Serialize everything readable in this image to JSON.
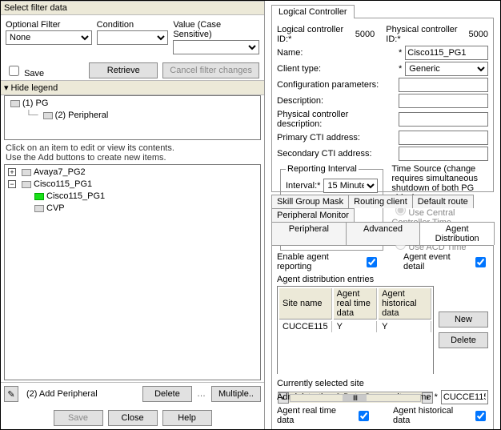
{
  "left": {
    "select_filter_title": "Select filter data",
    "optional_filter_label": "Optional Filter",
    "optional_filter_value": "None",
    "condition_label": "Condition",
    "condition_value": "",
    "value_label": "Value (Case Sensitive)",
    "value_value": "",
    "save_checkbox_label": "Save",
    "retrieve_btn": "Retrieve",
    "cancel_filter_btn": "Cancel filter changes",
    "hide_legend_label": "Hide legend",
    "legend_tree": {
      "item1": "(1) PG",
      "item2": "(2) Peripheral"
    },
    "instruction_line1": "Click on an item to edit or view its contents.",
    "instruction_line2": "Use the Add buttons to create new items.",
    "main_tree": {
      "n0": "Avaya7_PG2",
      "n1": "Cisco115_PG1",
      "n2": "Cisco115_PG1",
      "n3": "CVP"
    },
    "add_peripheral_label": "(2) Add Peripheral",
    "delete_btn": "Delete",
    "multiple_btn": "Multiple..",
    "save_btn": "Save",
    "close_btn": "Close",
    "help_btn": "Help"
  },
  "right": {
    "tab_logical": "Logical Controller",
    "logical_id_label": "Logical controller ID:",
    "logical_id_value": "5000",
    "physical_id_label": "Physical controller ID:",
    "physical_id_value": "5000",
    "name_label": "Name:",
    "name_value": "Cisco115_PG1",
    "client_type_label": "Client type:",
    "client_type_value": "Generic",
    "config_params_label": "Configuration parameters:",
    "config_params_value": "",
    "description_label": "Description:",
    "description_value": "",
    "phys_desc_label": "Physical controller description:",
    "phys_desc_value": "",
    "primary_cti_label": "Primary CTI address:",
    "primary_cti_value": "",
    "secondary_cti_label": "Secondary CTI address:",
    "secondary_cti_value": "",
    "reporting_interval_legend": "Reporting Interval",
    "interval_label": "Interval:",
    "interval_value": "15 Minute",
    "time_source_label": "Time Source (change requires simultaneous shutdown of both PG sides)",
    "ts_opt1": "Use Central Controller Time (Recommended)",
    "ts_opt2": "Use ACD Time",
    "tabs2_row1": {
      "t1": "Skill Group Mask",
      "t2": "Routing client",
      "t3": "Default route",
      "t4": "Peripheral Monitor"
    },
    "tabs2_row2": {
      "t1": "Peripheral",
      "t2": "Advanced",
      "t3": "Agent Distribution"
    },
    "enable_agent_reporting": "Enable agent reporting",
    "agent_event_detail": "Agent event detail",
    "agent_dist_entries": "Agent distribution entries",
    "tbl_h1": "Site name",
    "tbl_h2": "Agent real time data",
    "tbl_h3": "Agent historical data",
    "tbl_r1_c1": "CUCCE115",
    "tbl_r1_c2": "Y",
    "tbl_r1_c3": "Y",
    "new_btn": "New",
    "delete2_btn": "Delete",
    "currently_selected": "Currently selected site",
    "admin_site_label": "Administration & Data Server site name",
    "admin_site_value": "CUCCE115",
    "agent_rt_label": "Agent real time data",
    "agent_hist_label": "Agent historical data",
    "star": "*"
  }
}
